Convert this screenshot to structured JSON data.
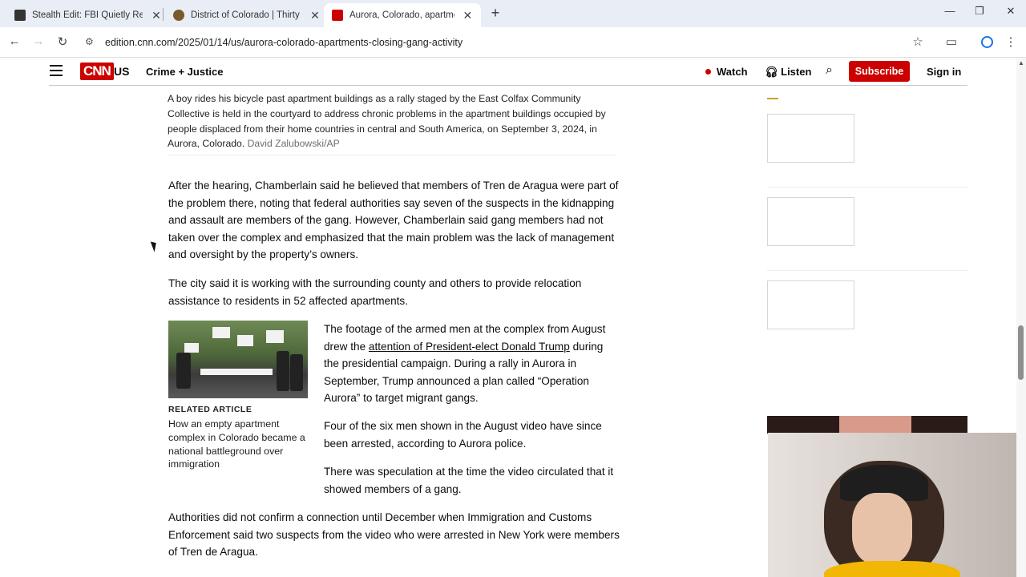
{
  "browser": {
    "tabs": [
      {
        "title": "Stealth Edit: FBI Quietly Revises",
        "favicon_color": "#333333",
        "active": false
      },
      {
        "title": "District of Colorado | Thirty Cha",
        "favicon_color": "#7a5a2a",
        "active": false
      },
      {
        "title": "Aurora, Colorado, apartment co",
        "favicon_color": "#cc0000",
        "active": true
      }
    ],
    "url": "edition.cnn.com/2025/01/14/us/aurora-colorado-apartments-closing-gang-activity",
    "icons": {
      "back": "←",
      "forward": "→",
      "reload": "↻",
      "new_tab": "+",
      "minimize": "—",
      "restore": "❐",
      "close": "✕",
      "bookmark": "☆",
      "sidebar": "▭",
      "menu": "⋮"
    }
  },
  "cnn": {
    "logo": "CNN",
    "edition": "US",
    "section": "Crime + Justice",
    "watch": "Watch",
    "listen": "Listen",
    "subscribe": "Subscribe",
    "signin": "Sign in",
    "brand_color": "#cc0000"
  },
  "article": {
    "caption": "A boy rides his bicycle past apartment buildings as a rally staged by the East Colfax Community Collective is held in the courtyard to address chronic problems in the apartment buildings occupied by people displaced from their home countries in central and South America, on September 3, 2024, in Aurora, Colorado.",
    "credit": "David Zalubowski/AP",
    "p1": "After the hearing, Chamberlain said he believed that members of Tren de Aragua were part of the problem there, noting that federal authorities say seven of the suspects in the kidnapping and assault are members of the gang. However, Chamberlain said gang members had not taken over the complex and emphasized that the main problem was the lack of management and oversight by the property’s owners.",
    "p2": "The city said it is working with the surrounding county and others to provide relocation assistance to residents in 52 affected apartments.",
    "p3_before": "The footage of the armed men at the complex from August drew the ",
    "p3_link": "attention of President-elect Donald Trump",
    "p3_after": " during the presidential campaign. During a rally in Aurora in September, Trump announced a plan called “Operation Aurora” to target migrant gangs.",
    "p4": "Four of the six men shown in the August video have since been arrested, according to Aurora police.",
    "p5": "There was speculation at the time the video circulated that it showed members of a gang.",
    "p6": "Authorities did not confirm a connection until December when Immigration and Customs Enforcement said two suspects from the video who were arrested in New York were members of Tren de Aragua.",
    "related": {
      "label": "RELATED ARTICLE",
      "title": "How an empty apartment complex in Colorado became a national battleground over immigration"
    }
  }
}
